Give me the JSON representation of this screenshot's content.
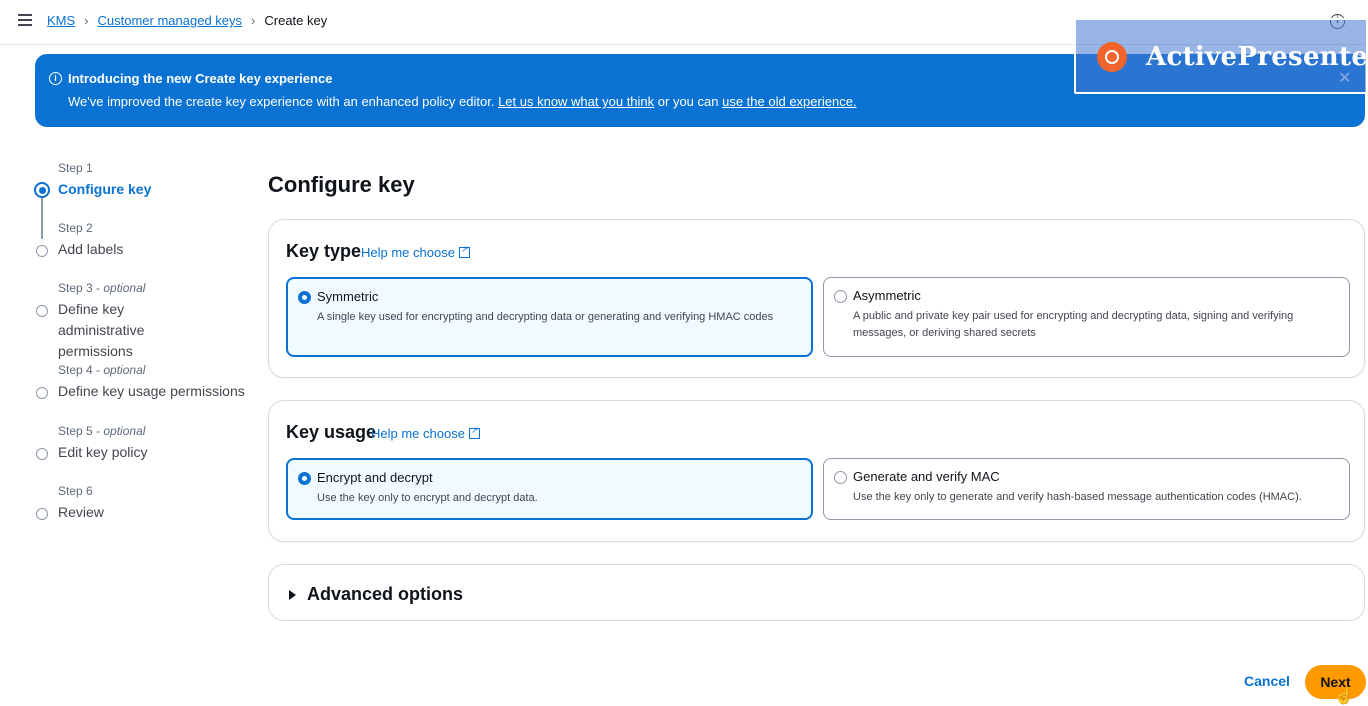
{
  "breadcrumb": {
    "items": [
      "KMS",
      "Customer managed keys"
    ],
    "current": "Create key"
  },
  "flash": {
    "title": "Introducing the new Create key experience",
    "body_prefix": "We've improved the create key experience with an enhanced policy editor.",
    "link1": "Let us know what you think",
    "middle": "or you can",
    "link2": "use the old experience."
  },
  "watermark": {
    "text": "ActivePresenter"
  },
  "steps": [
    {
      "label": "Step 1",
      "optional": "",
      "name": "Configure key",
      "active": true
    },
    {
      "label": "Step 2",
      "optional": "",
      "name": "Add labels",
      "active": false
    },
    {
      "label": "Step 3",
      "optional": "optional",
      "name": "Define key administrative permissions",
      "active": false
    },
    {
      "label": "Step 4",
      "optional": "optional",
      "name": "Define key usage permissions",
      "active": false
    },
    {
      "label": "Step 5",
      "optional": "optional",
      "name": "Edit key policy",
      "active": false
    },
    {
      "label": "Step 6",
      "optional": "",
      "name": "Review",
      "active": false
    }
  ],
  "main": {
    "title": "Configure key",
    "key_type": {
      "heading": "Key type",
      "help": "Help me choose",
      "options": [
        {
          "title": "Symmetric",
          "desc": "A single key used for encrypting and decrypting data or generating and verifying HMAC codes",
          "selected": true
        },
        {
          "title": "Asymmetric",
          "desc": "A public and private key pair used for encrypting and decrypting data, signing and verifying messages, or deriving shared secrets",
          "selected": false
        }
      ]
    },
    "key_usage": {
      "heading": "Key usage",
      "help": "Help me choose",
      "options": [
        {
          "title": "Encrypt and decrypt",
          "desc": "Use the key only to encrypt and decrypt data.",
          "selected": true
        },
        {
          "title": "Generate and verify MAC",
          "desc": "Use the key only to generate and verify hash-based message authentication codes (HMAC).",
          "selected": false
        }
      ]
    },
    "advanced": "Advanced options"
  },
  "footer": {
    "cancel": "Cancel",
    "next": "Next"
  },
  "colors": {
    "accent": "#0972d3",
    "primary_button": "#ff9900",
    "flash_bg": "#0972d3"
  }
}
